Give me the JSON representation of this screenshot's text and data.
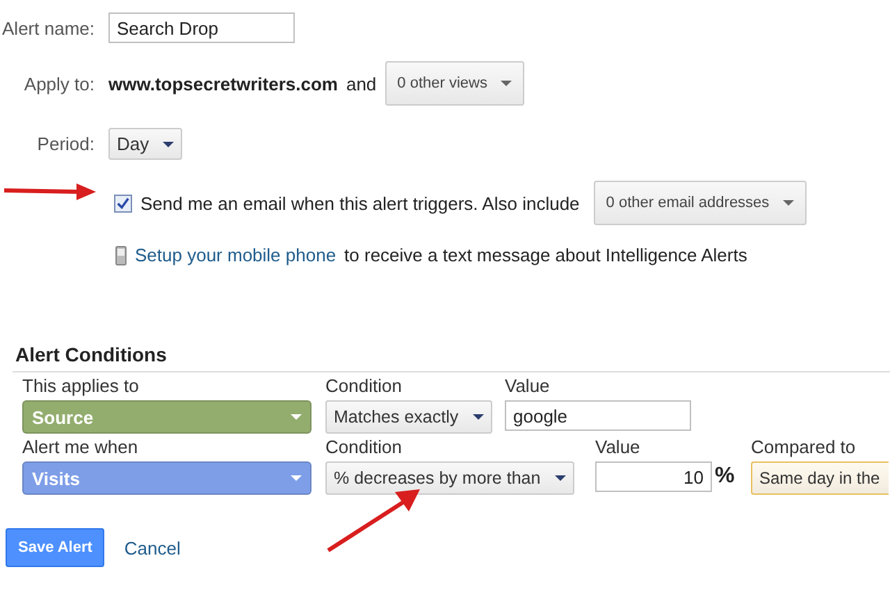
{
  "settings": {
    "alert_name": {
      "label": "Alert name:",
      "value": "Search Drop"
    },
    "apply_to": {
      "label": "Apply to:",
      "site": "www.topsecretwriters.com",
      "joiner": "and",
      "views_dropdown": "0 other views"
    },
    "period": {
      "label": "Period:",
      "value": "Day"
    },
    "email": {
      "checked": true,
      "text": "Send me an email when this alert triggers. Also include",
      "addresses_dropdown": "0 other email addresses"
    },
    "mobile": {
      "link": "Setup your mobile phone",
      "text": "to receive a text message about Intelligence Alerts"
    }
  },
  "conditions": {
    "title": "Alert Conditions",
    "rows": [
      {
        "kind": "filter",
        "label": "This applies to",
        "dimension": "Source",
        "color": "#93ad6e",
        "condition_label": "Condition",
        "condition": "Matches exactly",
        "value_label": "Value",
        "value": "google"
      },
      {
        "kind": "trigger",
        "label": "Alert me when",
        "dimension": "Visits",
        "color": "#7e9ee8",
        "condition_label": "Condition",
        "condition": "% decreases by more than",
        "value_label": "Value",
        "value": "10",
        "unit": "%",
        "compared_label": "Compared to",
        "compared": "Same day in the"
      }
    ]
  },
  "buttons": {
    "save": "Save Alert",
    "cancel": "Cancel"
  }
}
